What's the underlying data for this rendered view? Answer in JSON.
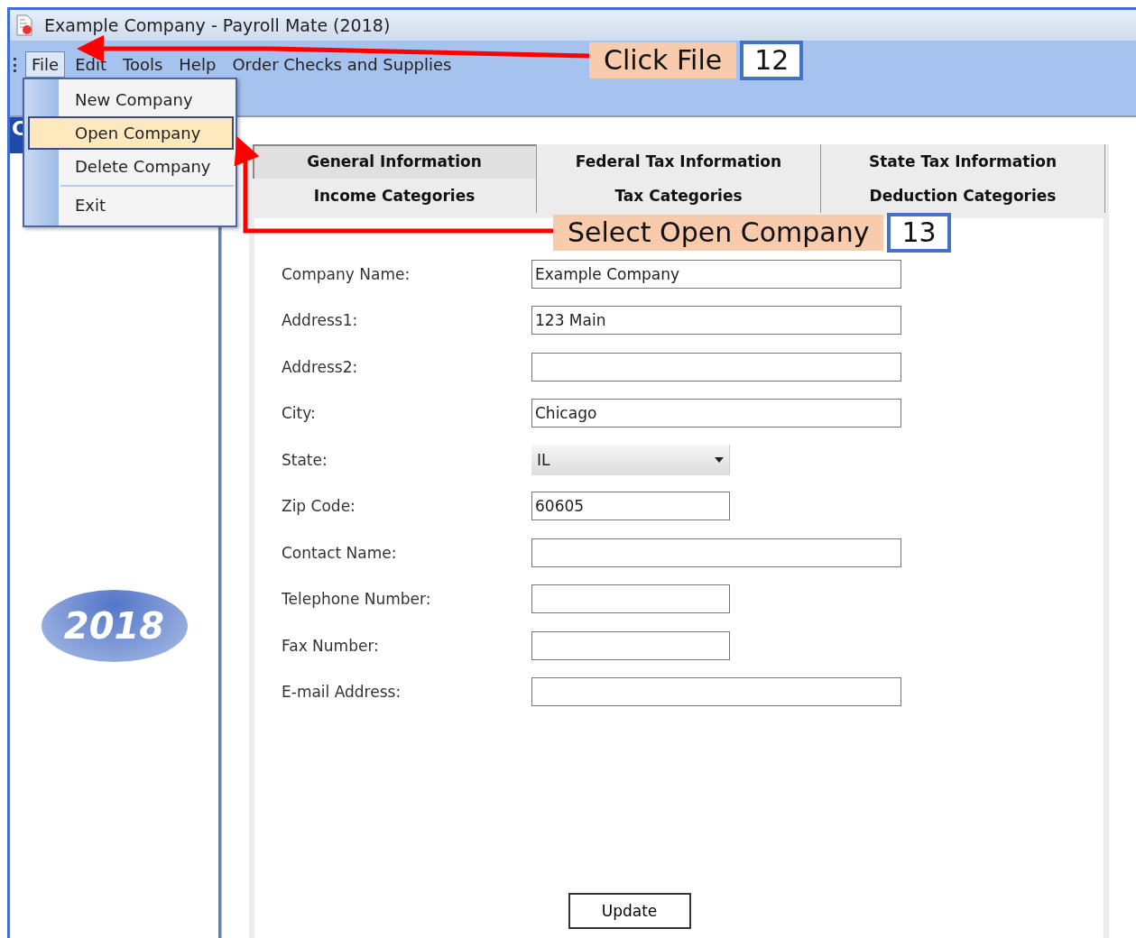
{
  "window": {
    "title": "Example Company - Payroll Mate (2018)"
  },
  "menu_bar": [
    {
      "label": "File",
      "selected": true
    },
    {
      "label": "Edit",
      "selected": false
    },
    {
      "label": "Tools",
      "selected": false
    },
    {
      "label": "Help",
      "selected": false
    },
    {
      "label": "Order Checks and Supplies",
      "selected": false
    }
  ],
  "file_menu": [
    {
      "label": "New Company",
      "selected": false,
      "separator_after": false
    },
    {
      "label": "Open Company",
      "selected": true,
      "separator_after": false
    },
    {
      "label": "Delete Company",
      "selected": false,
      "separator_after": true
    },
    {
      "label": "Exit",
      "selected": false,
      "separator_after": false
    }
  ],
  "sidebar": {
    "header": "C",
    "logo": "2018"
  },
  "tabs": [
    [
      {
        "label": "General Information",
        "selected": true
      },
      {
        "label": "Federal Tax Information",
        "selected": false
      },
      {
        "label": "State Tax Information",
        "selected": false
      }
    ],
    [
      {
        "label": "Income Categories",
        "selected": false
      },
      {
        "label": "Tax Categories",
        "selected": false
      },
      {
        "label": "Deduction Categories",
        "selected": false
      }
    ]
  ],
  "form": [
    {
      "label": "Company Name:",
      "kind": "long-text",
      "value": "Example Company"
    },
    {
      "label": "Address1:",
      "kind": "long-text",
      "value": "123 Main"
    },
    {
      "label": "Address2:",
      "kind": "long-text"
    },
    {
      "label": "City:",
      "kind": "long-text",
      "value": "Chicago"
    },
    {
      "label": "State:",
      "kind": "select",
      "value": "IL"
    },
    {
      "label": "Zip Code:",
      "kind": "short-text",
      "value": "60605"
    },
    {
      "label": "Contact Name:",
      "kind": "long-text"
    },
    {
      "label": "Telephone Number:",
      "kind": "short-text"
    },
    {
      "label": "Fax Number:",
      "kind": "short-text"
    },
    {
      "label": "E-mail Address:",
      "kind": "long-text"
    }
  ],
  "update_button": "Update",
  "callouts": [
    {
      "text": "Click File",
      "step": "12"
    },
    {
      "text": "Select Open Company",
      "step": "13"
    }
  ]
}
